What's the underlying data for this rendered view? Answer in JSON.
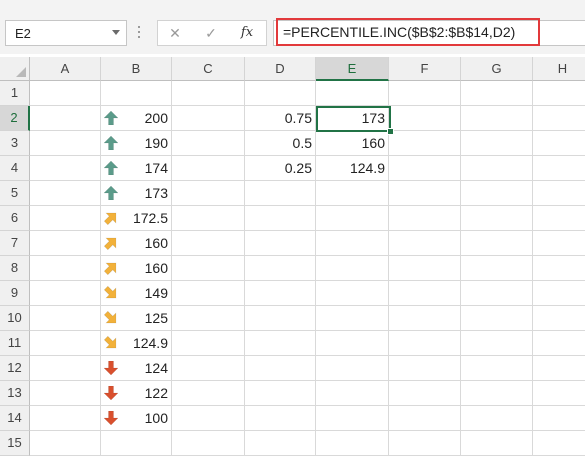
{
  "name_box": {
    "value": "E2"
  },
  "formula_bar": {
    "cancel_glyph": "✕",
    "enter_glyph": "✓",
    "fx_label": "fx",
    "formula": "=PERCENTILE.INC($B$2:$B$14,D2)"
  },
  "columns": [
    "A",
    "B",
    "C",
    "D",
    "E",
    "F",
    "G",
    "H"
  ],
  "active_column": "E",
  "rows": [
    {
      "num": "1",
      "b": "",
      "icon": "",
      "d": "",
      "e": ""
    },
    {
      "num": "2",
      "b": "200",
      "icon": "up",
      "d": "0.75",
      "e": "173"
    },
    {
      "num": "3",
      "b": "190",
      "icon": "up",
      "d": "0.5",
      "e": "160"
    },
    {
      "num": "4",
      "b": "174",
      "icon": "up",
      "d": "0.25",
      "e": "124.9"
    },
    {
      "num": "5",
      "b": "173",
      "icon": "up",
      "d": "",
      "e": ""
    },
    {
      "num": "6",
      "b": "172.5",
      "icon": "up-right",
      "d": "",
      "e": ""
    },
    {
      "num": "7",
      "b": "160",
      "icon": "up-right",
      "d": "",
      "e": ""
    },
    {
      "num": "8",
      "b": "160",
      "icon": "up-right",
      "d": "",
      "e": ""
    },
    {
      "num": "9",
      "b": "149",
      "icon": "down-right",
      "d": "",
      "e": ""
    },
    {
      "num": "10",
      "b": "125",
      "icon": "down-right",
      "d": "",
      "e": ""
    },
    {
      "num": "11",
      "b": "124.9",
      "icon": "down-right",
      "d": "",
      "e": ""
    },
    {
      "num": "12",
      "b": "124",
      "icon": "down",
      "d": "",
      "e": ""
    },
    {
      "num": "13",
      "b": "122",
      "icon": "down",
      "d": "",
      "e": ""
    },
    {
      "num": "14",
      "b": "100",
      "icon": "down",
      "d": "",
      "e": ""
    },
    {
      "num": "15",
      "b": "",
      "icon": "",
      "d": "",
      "e": ""
    }
  ],
  "active_row": "2",
  "icon_names": {
    "up": "arrow-up-icon",
    "up-right": "arrow-up-right-icon",
    "down-right": "arrow-down-right-icon",
    "down": "arrow-down-icon"
  },
  "colors": {
    "accent_green": "#217346",
    "arrow_up": "#5b9b8a",
    "arrow_diag": "#f2b13a",
    "arrow_down": "#d9502e",
    "formula_highlight": "#e2393b"
  }
}
